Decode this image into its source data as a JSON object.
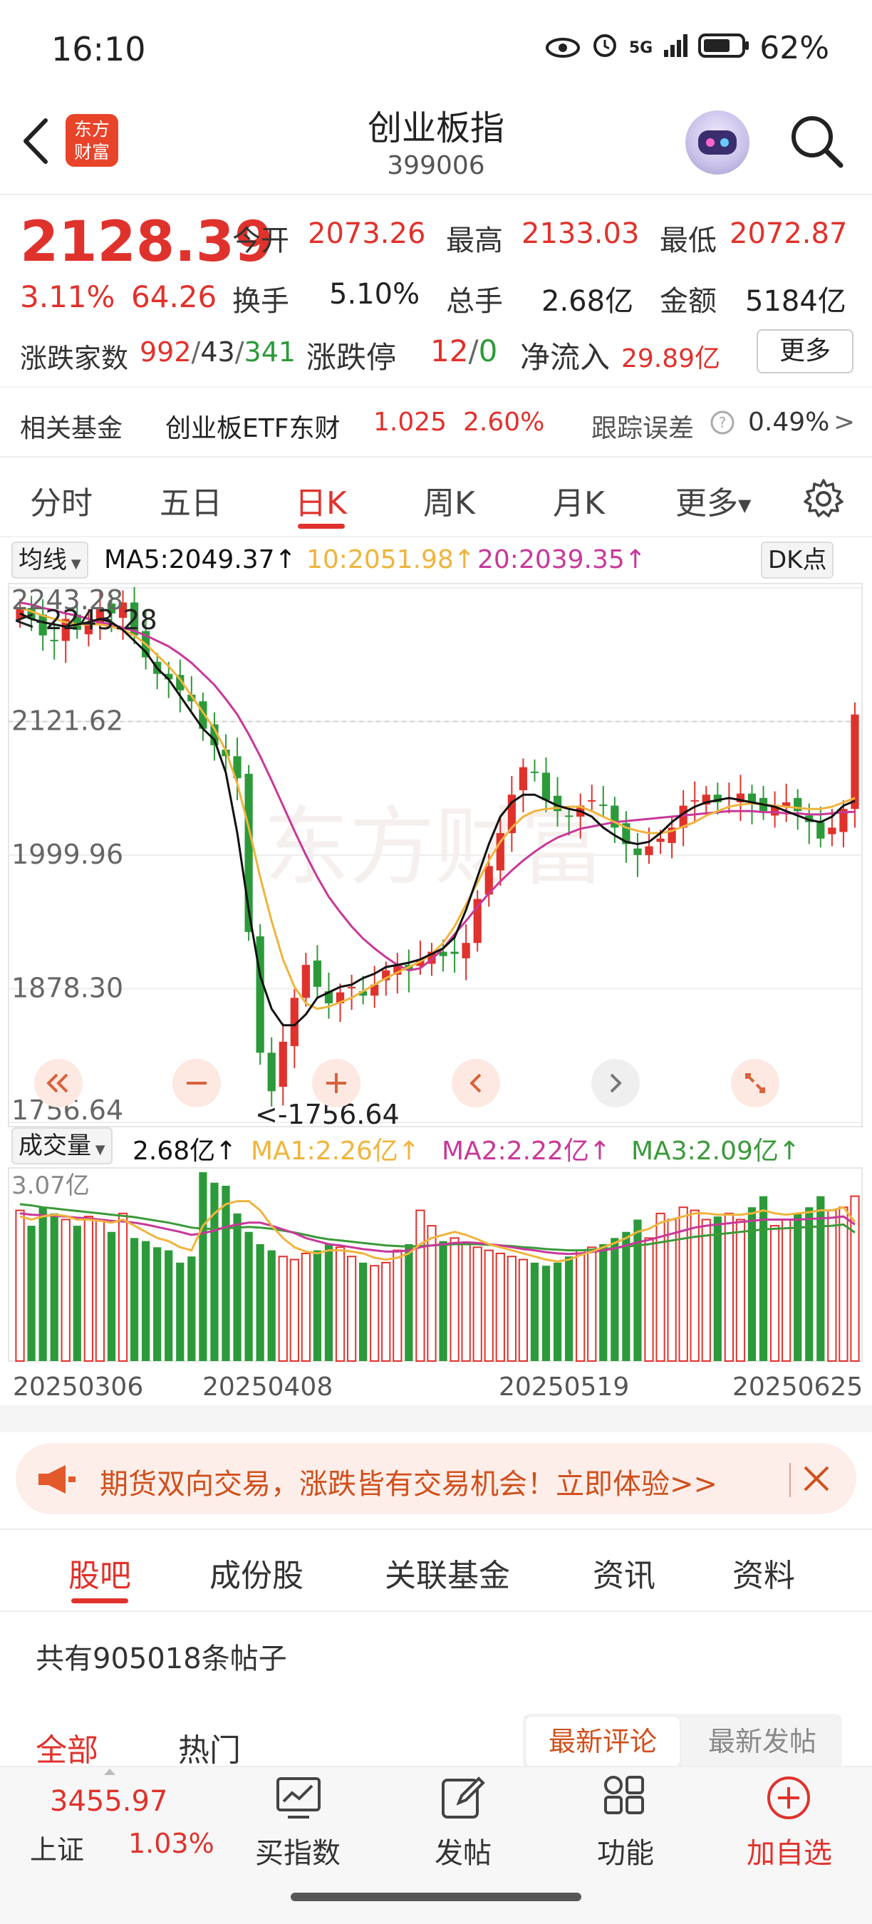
{
  "status_bar": {
    "time": "16:10",
    "network": "5G",
    "battery": "62%"
  },
  "header": {
    "logo_text": "东方财富",
    "title": "创业板指",
    "code": "399006"
  },
  "quote": {
    "price": "2128.39",
    "change_pct": "3.11%",
    "change": "64.26",
    "open_label": "今开",
    "open": "2073.26",
    "high_label": "最高",
    "high": "2133.03",
    "low_label": "最低",
    "low": "2072.87",
    "turnover_label": "换手",
    "turnover": "5.10%",
    "volume_label": "总手",
    "volume": "2.68亿",
    "amount_label": "金额",
    "amount": "5184亿",
    "breadth_label": "涨跌家数",
    "up_count": "992",
    "flat_count": "43",
    "down_count": "341",
    "limit_label": "涨跌停",
    "limit_up": "12",
    "limit_down": "0",
    "inflow_label": "净流入",
    "inflow": "29.89亿",
    "more_label": "更多"
  },
  "fund": {
    "label": "相关基金",
    "name": "创业板ETF东财",
    "price": "1.025",
    "pct": "2.60%",
    "tracking_label": "跟踪误差",
    "tracking_value": "0.49%",
    "arrow": ">"
  },
  "chart_tabs": [
    "分时",
    "五日",
    "日K",
    "周K",
    "月K",
    "更多"
  ],
  "active_chart_tab": "日K",
  "ma_bar": {
    "selector": "均线",
    "ma5": "MA5:2049.37↑",
    "ma10": "10:2051.98↑",
    "ma20": "20:2039.35↑",
    "dk": "DK点"
  },
  "vol_bar": {
    "selector": "成交量",
    "value": "2.68亿↑",
    "ma1": "MA1:2.26亿↑",
    "ma2": "MA2:2.22亿↑",
    "ma3": "MA3:2.09亿↑"
  },
  "chart_data": {
    "type": "candlestick",
    "price_axis_labels": [
      "2243.28",
      "2121.62",
      "1999.96",
      "1878.30",
      "1756.64"
    ],
    "price_ylim": [
      1756.64,
      2243.28
    ],
    "high_marker": "<-2243.28",
    "low_marker": "<-1756.64",
    "volume_axis_label": "3.07亿",
    "volume_ylim": [
      0,
      3.07
    ],
    "x_labels": [
      "20250306",
      "20250408",
      "20250519",
      "20250625"
    ],
    "closes": [
      2225,
      2215,
      2200,
      2195,
      2215,
      2205,
      2210,
      2225,
      2220,
      2230,
      2200,
      2180,
      2165,
      2160,
      2150,
      2140,
      2115,
      2100,
      2090,
      2070,
      1930,
      1820,
      1785,
      1830,
      1870,
      1900,
      1880,
      1865,
      1875,
      1880,
      1872,
      1882,
      1895,
      1900,
      1895,
      1905,
      1912,
      1908,
      1910,
      1920,
      1960,
      1990,
      2020,
      2055,
      2080,
      2075,
      2050,
      2040,
      2035,
      2045,
      2050,
      2045,
      2025,
      2010,
      2000,
      2008,
      2015,
      2025,
      2045,
      2050,
      2055,
      2048,
      2052,
      2056,
      2048,
      2040,
      2044,
      2048,
      2040,
      2030,
      2015,
      2025,
      2042,
      2128
    ],
    "volumes": [
      2.45,
      2.2,
      2.5,
      2.4,
      2.3,
      2.2,
      2.35,
      2.3,
      2.1,
      2.4,
      2.0,
      1.95,
      1.85,
      1.8,
      1.6,
      1.7,
      3.07,
      2.9,
      2.85,
      2.4,
      2.1,
      1.9,
      1.8,
      1.7,
      1.65,
      1.75,
      1.8,
      1.9,
      1.85,
      1.7,
      1.6,
      1.55,
      1.6,
      1.8,
      1.9,
      2.45,
      2.2,
      1.95,
      2.0,
      1.9,
      1.85,
      1.8,
      1.75,
      1.7,
      1.65,
      1.6,
      1.55,
      1.6,
      1.7,
      1.8,
      1.85,
      1.9,
      2.0,
      2.1,
      2.3,
      2.0,
      2.4,
      2.3,
      2.5,
      2.45,
      2.3,
      2.35,
      2.4,
      2.3,
      2.5,
      2.68,
      2.2,
      2.3,
      2.4,
      2.5,
      2.68,
      2.45,
      2.5,
      2.68
    ],
    "ma5": [
      2220,
      2215,
      2212,
      2210,
      2208,
      2210,
      2212,
      2215,
      2212,
      2205,
      2195,
      2185,
      2170,
      2160,
      2145,
      2130,
      2115,
      2105,
      2075,
      2020,
      1950,
      1890,
      1860,
      1845,
      1845,
      1855,
      1870,
      1875,
      1880,
      1882,
      1888,
      1892,
      1898,
      1900,
      1902,
      1905,
      1910,
      1915,
      1925,
      1950,
      1980,
      2010,
      2035,
      2048,
      2055,
      2055,
      2050,
      2045,
      2042,
      2040,
      2035,
      2025,
      2018,
      2012,
      2010,
      2012,
      2020,
      2030,
      2038,
      2044,
      2048,
      2050,
      2052,
      2050,
      2048,
      2046,
      2044,
      2040,
      2036,
      2032,
      2030,
      2035,
      2045,
      2049.37
    ],
    "ma10": [
      2225,
      2222,
      2218,
      2215,
      2212,
      2210,
      2210,
      2210,
      2208,
      2205,
      2200,
      2192,
      2182,
      2172,
      2160,
      2145,
      2130,
      2115,
      2095,
      2065,
      2025,
      1980,
      1940,
      1905,
      1880,
      1865,
      1860,
      1862,
      1866,
      1870,
      1876,
      1882,
      1888,
      1893,
      1898,
      1903,
      1910,
      1920,
      1935,
      1955,
      1975,
      1995,
      2012,
      2025,
      2035,
      2040,
      2042,
      2043,
      2044,
      2044,
      2040,
      2035,
      2030,
      2025,
      2022,
      2020,
      2020,
      2022,
      2026,
      2030,
      2036,
      2040,
      2044,
      2046,
      2047,
      2046,
      2045,
      2044,
      2043,
      2042,
      2042,
      2044,
      2048,
      2051.98
    ],
    "ma20": [
      2230,
      2228,
      2225,
      2223,
      2220,
      2218,
      2215,
      2212,
      2210,
      2207,
      2204,
      2200,
      2195,
      2190,
      2183,
      2175,
      2165,
      2155,
      2142,
      2128,
      2110,
      2090,
      2068,
      2045,
      2022,
      2000,
      1980,
      1962,
      1948,
      1935,
      1924,
      1915,
      1907,
      1900,
      1895,
      1897,
      1905,
      1915,
      1928,
      1940,
      1953,
      1965,
      1976,
      1986,
      1995,
      2003,
      2010,
      2016,
      2020,
      2024,
      2026,
      2028,
      2030,
      2031,
      2032,
      2033,
      2034,
      2035,
      2036,
      2037,
      2038,
      2039,
      2040,
      2040,
      2040,
      2039,
      2039,
      2038,
      2038,
      2037,
      2037,
      2038,
      2039,
      2039.35
    ],
    "vol_ma1": [
      2.35,
      2.3,
      2.35,
      2.38,
      2.36,
      2.3,
      2.3,
      2.28,
      2.25,
      2.3,
      2.2,
      2.1,
      2.0,
      1.95,
      1.85,
      1.8,
      2.2,
      2.4,
      2.55,
      2.6,
      2.6,
      2.45,
      2.2,
      2.0,
      1.85,
      1.78,
      1.75,
      1.8,
      1.8,
      1.78,
      1.75,
      1.68,
      1.65,
      1.68,
      1.75,
      1.9,
      2.0,
      2.05,
      2.1,
      2.05,
      1.98,
      1.9,
      1.85,
      1.8,
      1.75,
      1.7,
      1.65,
      1.62,
      1.65,
      1.72,
      1.78,
      1.85,
      1.92,
      2.0,
      2.1,
      2.15,
      2.25,
      2.3,
      2.35,
      2.4,
      2.4,
      2.38,
      2.38,
      2.38,
      2.4,
      2.45,
      2.4,
      2.38,
      2.4,
      2.42,
      2.45,
      2.45,
      2.5,
      2.26
    ],
    "vol_ma2": [
      2.4,
      2.38,
      2.37,
      2.36,
      2.35,
      2.33,
      2.32,
      2.3,
      2.28,
      2.27,
      2.25,
      2.22,
      2.18,
      2.14,
      2.1,
      2.05,
      2.08,
      2.12,
      2.18,
      2.22,
      2.25,
      2.25,
      2.2,
      2.14,
      2.08,
      2.0,
      1.95,
      1.9,
      1.88,
      1.85,
      1.82,
      1.8,
      1.78,
      1.78,
      1.8,
      1.85,
      1.88,
      1.9,
      1.92,
      1.93,
      1.92,
      1.9,
      1.88,
      1.85,
      1.82,
      1.8,
      1.77,
      1.75,
      1.74,
      1.75,
      1.77,
      1.8,
      1.83,
      1.88,
      1.93,
      1.97,
      2.02,
      2.07,
      2.12,
      2.17,
      2.2,
      2.22,
      2.24,
      2.26,
      2.28,
      2.3,
      2.3,
      2.3,
      2.3,
      2.31,
      2.32,
      2.33,
      2.35,
      2.22
    ],
    "vol_ma3": [
      2.55,
      2.53,
      2.5,
      2.48,
      2.46,
      2.44,
      2.42,
      2.4,
      2.38,
      2.36,
      2.34,
      2.31,
      2.28,
      2.25,
      2.21,
      2.17,
      2.15,
      2.15,
      2.16,
      2.17,
      2.18,
      2.17,
      2.15,
      2.12,
      2.09,
      2.05,
      2.01,
      1.98,
      1.96,
      1.94,
      1.92,
      1.9,
      1.88,
      1.87,
      1.86,
      1.87,
      1.88,
      1.89,
      1.9,
      1.9,
      1.9,
      1.89,
      1.88,
      1.87,
      1.85,
      1.84,
      1.82,
      1.81,
      1.8,
      1.8,
      1.81,
      1.82,
      1.84,
      1.86,
      1.88,
      1.9,
      1.93,
      1.96,
      1.99,
      2.02,
      2.04,
      2.06,
      2.08,
      2.1,
      2.12,
      2.14,
      2.15,
      2.16,
      2.17,
      2.18,
      2.19,
      2.2,
      2.22,
      2.09
    ]
  },
  "banner": {
    "text": "期货双向交易，涨跌皆有交易机会！立即体验>>"
  },
  "bottom_tabs": [
    "股吧",
    "成份股",
    "关联基金",
    "资讯",
    "资料"
  ],
  "posts": {
    "count_text": "共有905018条帖子",
    "filter_all": "全部",
    "filter_hot": "热门",
    "sort_latest_comment": "最新评论",
    "sort_latest_post": "最新发帖"
  },
  "bottom_nav": {
    "index_value": "3455.97",
    "index_name": "上证",
    "index_pct": "1.03%",
    "buy_index": "买指数",
    "post": "发帖",
    "functions": "功能",
    "add_watch": "加自选"
  },
  "colors": {
    "up": "#e0322c",
    "down": "#2c9a3a",
    "ma5": "#111111",
    "ma10": "#f0b43c",
    "ma20": "#c8389a",
    "vol_ma1": "#f0b43c",
    "vol_ma2": "#c8389a",
    "vol_ma3": "#3a9a3a"
  }
}
